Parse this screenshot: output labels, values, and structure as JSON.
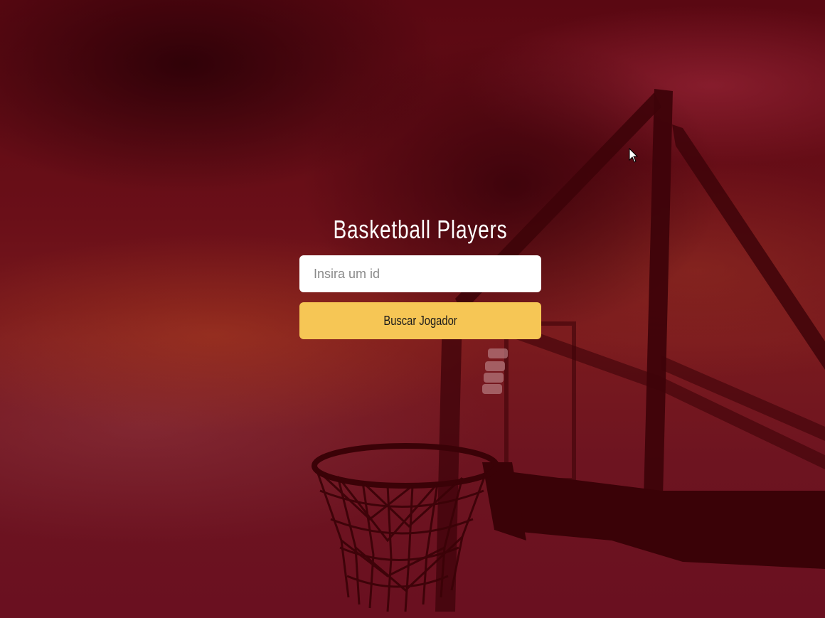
{
  "app": {
    "title": "Basketball Players"
  },
  "search": {
    "placeholder": "Insira um id",
    "value": ""
  },
  "actions": {
    "search_label": "Buscar Jogador"
  },
  "theme": {
    "background_tint": "#6a0f18",
    "button_color": "#f6c655",
    "title_color": "#ffffff"
  },
  "icons": {
    "cursor": "mouse-pointer-icon"
  }
}
